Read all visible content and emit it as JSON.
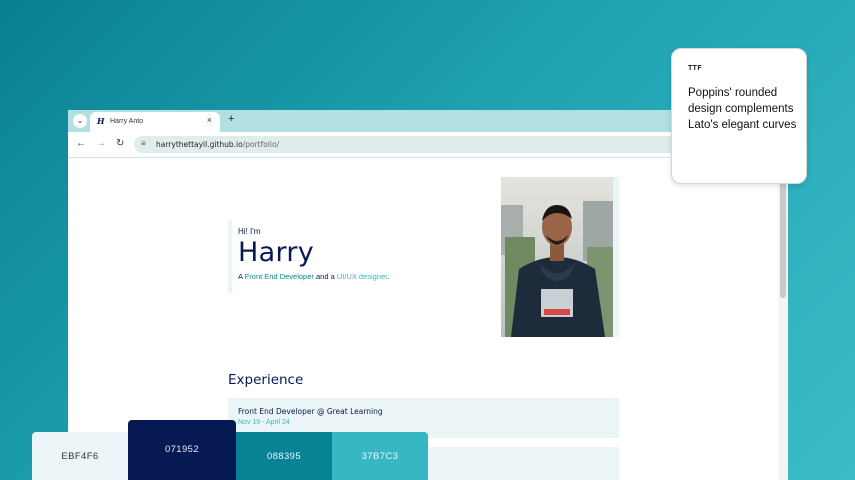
{
  "browser": {
    "tab_title": "Harry Anto",
    "tab_favicon": "H",
    "url_host": "harrythettayil.github.io",
    "url_path": "/portfolio/"
  },
  "hero": {
    "greeting": "Hi! I'm",
    "name": "Harry",
    "tagline_prefix": "A ",
    "role_1": "Front End Developer",
    "tagline_mid": " and a ",
    "role_2": "UI/UX designer",
    "tagline_suffix": "."
  },
  "experience": {
    "title": "Experience",
    "items": [
      {
        "role": "Front End Developer @ Great Learning",
        "dates": "Nov 19 - April 24"
      },
      {
        "role": "",
        "dates": ""
      }
    ]
  },
  "font_card": {
    "format": "TTF",
    "note": "Poppins' rounded design complements Lato's elegant curves"
  },
  "palette": [
    {
      "label": "EBF4F6",
      "color": "#ebf4f6"
    },
    {
      "label": "071952",
      "color": "#071952"
    },
    {
      "label": "088395",
      "color": "#088395"
    },
    {
      "label": "37B7C3",
      "color": "#37b7c3"
    }
  ],
  "icons": {
    "tab_list": "chevron-down-icon",
    "close": "close-icon",
    "new_tab": "plus-icon",
    "back": "arrow-left-icon",
    "forward": "arrow-right-icon",
    "reload": "reload-icon",
    "site_info": "tune-icon"
  }
}
